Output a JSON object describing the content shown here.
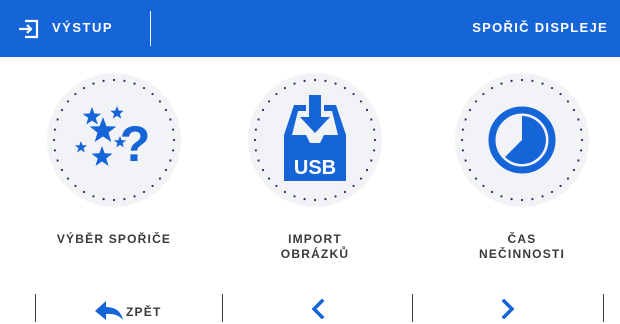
{
  "header": {
    "exit_label": "VÝSTUP",
    "title": "SPOŘIČ DISPLEJE"
  },
  "tiles": [
    {
      "label_line1": "VÝBĚR SPOŘIČE",
      "icon": "stars-question-icon"
    },
    {
      "label_line1": "IMPORT",
      "label_line2": "OBRÁZKŮ",
      "icon_text": "USB",
      "icon": "usb-import-icon"
    },
    {
      "label_line1": "ČAS",
      "label_line2": "NEČINNOSTI",
      "icon": "timer-icon"
    }
  ],
  "footer": {
    "back_label": "ZPĚT"
  },
  "colors": {
    "accent": "#1565d8",
    "text": "#3a3a3a",
    "tile_bg": "#f1f3f6",
    "dots": "#2a2a66"
  }
}
